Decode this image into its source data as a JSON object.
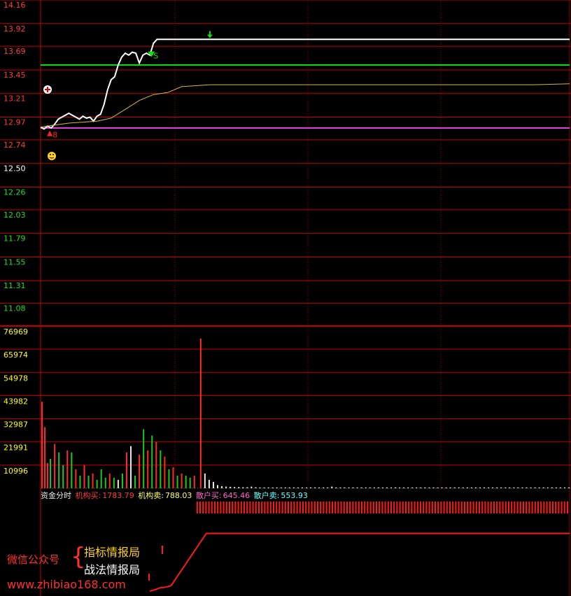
{
  "chart_data": [
    {
      "type": "line",
      "panel": "price",
      "y_ticks": [
        "14.16",
        "13.92",
        "13.69",
        "13.45",
        "13.21",
        "12.97",
        "12.74",
        "12.50",
        "12.26",
        "12.03",
        "11.79",
        "11.55",
        "11.31",
        "11.08"
      ],
      "ylim": [
        10.85,
        14.16
      ],
      "prev_close": 12.5,
      "series": [
        {
          "key": "price",
          "color": "#ffffff",
          "x": [
            0,
            5,
            10,
            15,
            20,
            25,
            30,
            35,
            40,
            45,
            50,
            55,
            60,
            65,
            70,
            75,
            80,
            85,
            90,
            95,
            100,
            105,
            110,
            115,
            120,
            125,
            130,
            135,
            140,
            145,
            150,
            155,
            160,
            165,
            170,
            175,
            180,
            185,
            190,
            195,
            200,
            205,
            210,
            215,
            220,
            225,
            230,
            235,
            240,
            750
          ],
          "values": [
            12.87,
            12.85,
            12.88,
            12.86,
            12.9,
            12.95,
            12.97,
            12.99,
            13.01,
            12.99,
            12.97,
            12.95,
            12.98,
            12.96,
            12.97,
            12.93,
            12.98,
            13.0,
            13.1,
            13.25,
            13.35,
            13.38,
            13.5,
            13.58,
            13.62,
            13.6,
            13.63,
            13.62,
            13.52,
            13.6,
            13.62,
            13.6,
            13.72,
            13.76,
            13.76,
            13.76,
            13.76,
            13.76,
            13.76,
            13.76,
            13.76,
            13.76,
            13.76,
            13.76,
            13.76,
            13.76,
            13.76,
            13.76,
            13.76,
            13.76
          ]
        },
        {
          "key": "avg",
          "color": "#d4b93a",
          "x": [
            0,
            20,
            40,
            60,
            80,
            100,
            120,
            140,
            160,
            180,
            200,
            220,
            240,
            300,
            400,
            500,
            600,
            700,
            750
          ],
          "values": [
            12.87,
            12.89,
            12.91,
            12.92,
            12.93,
            12.96,
            13.05,
            13.14,
            13.2,
            13.22,
            13.28,
            13.29,
            13.3,
            13.3,
            13.3,
            13.3,
            13.3,
            13.3,
            13.31
          ]
        }
      ],
      "hlines": [
        {
          "key": "green_line",
          "value": 13.5,
          "color": "#11e011"
        },
        {
          "key": "magenta_line",
          "value": 12.86,
          "color": "#e03ce0"
        }
      ],
      "markers": [
        {
          "key": "buy_marker",
          "x": 13,
          "value": 12.82,
          "text": "8",
          "color": "#ff2020"
        },
        {
          "key": "sell_marker",
          "x": 158,
          "value": 13.58,
          "text": "S",
          "color": "#11e011"
        },
        {
          "key": "down_arrow_marker",
          "x": 240,
          "value": 13.78,
          "text": "",
          "color": "#11e011"
        }
      ]
    },
    {
      "type": "bar",
      "panel": "volume",
      "y_ticks": [
        "76969",
        "65974",
        "54978",
        "43982",
        "32987",
        "21991",
        "10996"
      ],
      "ylim": [
        0,
        76969
      ],
      "bars": [
        {
          "x": 2,
          "v": 41000,
          "c": "r"
        },
        {
          "x": 6,
          "v": 29000,
          "c": "r"
        },
        {
          "x": 10,
          "v": 12000,
          "c": "r"
        },
        {
          "x": 14,
          "v": 14000,
          "c": "g"
        },
        {
          "x": 20,
          "v": 21000,
          "c": "r"
        },
        {
          "x": 26,
          "v": 17000,
          "c": "g"
        },
        {
          "x": 32,
          "v": 11000,
          "c": "g"
        },
        {
          "x": 38,
          "v": 18000,
          "c": "r"
        },
        {
          "x": 44,
          "v": 17000,
          "c": "g"
        },
        {
          "x": 50,
          "v": 9000,
          "c": "r"
        },
        {
          "x": 56,
          "v": 6000,
          "c": "g"
        },
        {
          "x": 62,
          "v": 11000,
          "c": "r"
        },
        {
          "x": 68,
          "v": 6000,
          "c": "g"
        },
        {
          "x": 74,
          "v": 7000,
          "c": "r"
        },
        {
          "x": 80,
          "v": 4000,
          "c": "g"
        },
        {
          "x": 86,
          "v": 9000,
          "c": "g"
        },
        {
          "x": 92,
          "v": 5000,
          "c": "g"
        },
        {
          "x": 98,
          "v": 7000,
          "c": "r"
        },
        {
          "x": 104,
          "v": 5000,
          "c": "g"
        },
        {
          "x": 110,
          "v": 4000,
          "c": "w"
        },
        {
          "x": 116,
          "v": 7000,
          "c": "g"
        },
        {
          "x": 122,
          "v": 17000,
          "c": "r"
        },
        {
          "x": 128,
          "v": 20000,
          "c": "w"
        },
        {
          "x": 134,
          "v": 6000,
          "c": "g"
        },
        {
          "x": 140,
          "v": 16000,
          "c": "r"
        },
        {
          "x": 146,
          "v": 28000,
          "c": "g"
        },
        {
          "x": 152,
          "v": 18000,
          "c": "r"
        },
        {
          "x": 158,
          "v": 25000,
          "c": "g"
        },
        {
          "x": 164,
          "v": 22000,
          "c": "r"
        },
        {
          "x": 170,
          "v": 18000,
          "c": "g"
        },
        {
          "x": 176,
          "v": 15000,
          "c": "r"
        },
        {
          "x": 182,
          "v": 9000,
          "c": "g"
        },
        {
          "x": 188,
          "v": 10000,
          "c": "r"
        },
        {
          "x": 194,
          "v": 6000,
          "c": "g"
        },
        {
          "x": 200,
          "v": 7000,
          "c": "r"
        },
        {
          "x": 206,
          "v": 6000,
          "c": "g"
        },
        {
          "x": 212,
          "v": 5000,
          "c": "g"
        },
        {
          "x": 218,
          "v": 6000,
          "c": "r"
        },
        {
          "x": 227,
          "v": 71000,
          "c": "r"
        },
        {
          "x": 233,
          "v": 7000,
          "c": "w"
        },
        {
          "x": 239,
          "v": 4000,
          "c": "w"
        },
        {
          "x": 245,
          "v": 3000,
          "c": "w"
        },
        {
          "x": 251,
          "v": 1500,
          "c": "w"
        },
        {
          "x": 257,
          "v": 1000,
          "c": "w"
        },
        {
          "x": 263,
          "v": 800,
          "c": "w"
        },
        {
          "x": 269,
          "v": 700,
          "c": "w"
        },
        {
          "x": 275,
          "v": 600,
          "c": "w"
        },
        {
          "x": 281,
          "v": 600,
          "c": "w"
        },
        {
          "x": 287,
          "v": 500,
          "c": "w"
        },
        {
          "x": 293,
          "v": 500,
          "c": "w"
        },
        {
          "x": 299,
          "v": 800,
          "c": "w"
        },
        {
          "x": 305,
          "v": 500,
          "c": "w"
        },
        {
          "x": 311,
          "v": 400,
          "c": "w"
        },
        {
          "x": 317,
          "v": 400,
          "c": "w"
        },
        {
          "x": 323,
          "v": 400,
          "c": "w"
        },
        {
          "x": 329,
          "v": 400,
          "c": "w"
        },
        {
          "x": 335,
          "v": 400,
          "c": "w"
        },
        {
          "x": 341,
          "v": 400,
          "c": "w"
        },
        {
          "x": 347,
          "v": 400,
          "c": "w"
        },
        {
          "x": 353,
          "v": 400,
          "c": "w"
        },
        {
          "x": 359,
          "v": 400,
          "c": "w"
        },
        {
          "x": 365,
          "v": 400,
          "c": "w"
        },
        {
          "x": 371,
          "v": 400,
          "c": "w"
        },
        {
          "x": 377,
          "v": 400,
          "c": "w"
        },
        {
          "x": 383,
          "v": 400,
          "c": "w"
        },
        {
          "x": 389,
          "v": 400,
          "c": "w"
        },
        {
          "x": 395,
          "v": 400,
          "c": "w"
        },
        {
          "x": 401,
          "v": 400,
          "c": "w"
        },
        {
          "x": 407,
          "v": 400,
          "c": "w"
        },
        {
          "x": 413,
          "v": 800,
          "c": "w"
        },
        {
          "x": 419,
          "v": 400,
          "c": "w"
        },
        {
          "x": 425,
          "v": 400,
          "c": "w"
        },
        {
          "x": 431,
          "v": 400,
          "c": "w"
        },
        {
          "x": 437,
          "v": 400,
          "c": "w"
        },
        {
          "x": 443,
          "v": 400,
          "c": "w"
        },
        {
          "x": 449,
          "v": 400,
          "c": "w"
        },
        {
          "x": 455,
          "v": 400,
          "c": "w"
        },
        {
          "x": 461,
          "v": 400,
          "c": "w"
        },
        {
          "x": 467,
          "v": 400,
          "c": "w"
        },
        {
          "x": 473,
          "v": 400,
          "c": "w"
        },
        {
          "x": 479,
          "v": 400,
          "c": "w"
        },
        {
          "x": 485,
          "v": 400,
          "c": "w"
        },
        {
          "x": 491,
          "v": 400,
          "c": "w"
        },
        {
          "x": 497,
          "v": 400,
          "c": "w"
        },
        {
          "x": 503,
          "v": 400,
          "c": "w"
        },
        {
          "x": 509,
          "v": 400,
          "c": "w"
        },
        {
          "x": 515,
          "v": 400,
          "c": "w"
        },
        {
          "x": 521,
          "v": 400,
          "c": "w"
        },
        {
          "x": 527,
          "v": 400,
          "c": "w"
        },
        {
          "x": 533,
          "v": 400,
          "c": "w"
        },
        {
          "x": 539,
          "v": 400,
          "c": "w"
        },
        {
          "x": 545,
          "v": 400,
          "c": "w"
        },
        {
          "x": 551,
          "v": 400,
          "c": "w"
        },
        {
          "x": 557,
          "v": 400,
          "c": "w"
        },
        {
          "x": 563,
          "v": 400,
          "c": "w"
        },
        {
          "x": 569,
          "v": 400,
          "c": "w"
        },
        {
          "x": 575,
          "v": 400,
          "c": "w"
        },
        {
          "x": 581,
          "v": 400,
          "c": "w"
        },
        {
          "x": 587,
          "v": 400,
          "c": "w"
        },
        {
          "x": 593,
          "v": 400,
          "c": "w"
        },
        {
          "x": 599,
          "v": 400,
          "c": "w"
        },
        {
          "x": 605,
          "v": 400,
          "c": "w"
        },
        {
          "x": 611,
          "v": 400,
          "c": "w"
        },
        {
          "x": 617,
          "v": 400,
          "c": "w"
        },
        {
          "x": 623,
          "v": 400,
          "c": "w"
        },
        {
          "x": 629,
          "v": 400,
          "c": "w"
        },
        {
          "x": 635,
          "v": 400,
          "c": "w"
        },
        {
          "x": 641,
          "v": 400,
          "c": "w"
        },
        {
          "x": 647,
          "v": 400,
          "c": "w"
        },
        {
          "x": 653,
          "v": 400,
          "c": "w"
        },
        {
          "x": 659,
          "v": 400,
          "c": "w"
        },
        {
          "x": 665,
          "v": 400,
          "c": "w"
        },
        {
          "x": 671,
          "v": 400,
          "c": "w"
        },
        {
          "x": 677,
          "v": 400,
          "c": "w"
        },
        {
          "x": 683,
          "v": 400,
          "c": "w"
        },
        {
          "x": 689,
          "v": 400,
          "c": "w"
        },
        {
          "x": 695,
          "v": 400,
          "c": "w"
        },
        {
          "x": 701,
          "v": 400,
          "c": "w"
        },
        {
          "x": 707,
          "v": 400,
          "c": "w"
        },
        {
          "x": 713,
          "v": 400,
          "c": "w"
        },
        {
          "x": 719,
          "v": 400,
          "c": "w"
        },
        {
          "x": 725,
          "v": 400,
          "c": "w"
        },
        {
          "x": 731,
          "v": 400,
          "c": "w"
        },
        {
          "x": 737,
          "v": 400,
          "c": "w"
        },
        {
          "x": 743,
          "v": 400,
          "c": "w"
        },
        {
          "x": 749,
          "v": 400,
          "c": "w"
        }
      ]
    },
    {
      "type": "line",
      "panel": "fund_flow",
      "series": [
        {
          "key": "fund_step",
          "color": "#ff1a1a",
          "x": [
            155,
            162,
            170,
            178,
            185,
            235,
            750
          ],
          "values": [
            0.0,
            0.02,
            0.05,
            0.06,
            0.08,
            0.85,
            0.85
          ]
        }
      ],
      "tick_band": {
        "from_x": 222,
        "to_x": 750,
        "color": "#ff1a1a"
      }
    }
  ],
  "colors": {
    "grid": "#8b0000",
    "grid_strong": "#c00000",
    "axis_red": "#ff3b3b",
    "axis_green": "#22dd22",
    "axis_yellow": "#ffff00",
    "bar_red": "#ff2a2a",
    "bar_green": "#1ec81e",
    "bar_white": "#e8e8e8"
  },
  "legend": {
    "title": "资金分时",
    "inst_buy_label": "机构买:",
    "inst_buy_value": "1783.79",
    "inst_sell_label": "机构卖:",
    "inst_sell_value": "788.03",
    "retail_buy_label": "散户买:",
    "retail_buy_value": "645.46",
    "retail_sell_label": "散户卖:",
    "retail_sell_value": "553.93"
  },
  "watermark": {
    "wechat_label": "微信公众号",
    "brace": "{",
    "line1": "指标情报局",
    "line2": "战法情报局",
    "url": "www.zhibiao168.com"
  }
}
